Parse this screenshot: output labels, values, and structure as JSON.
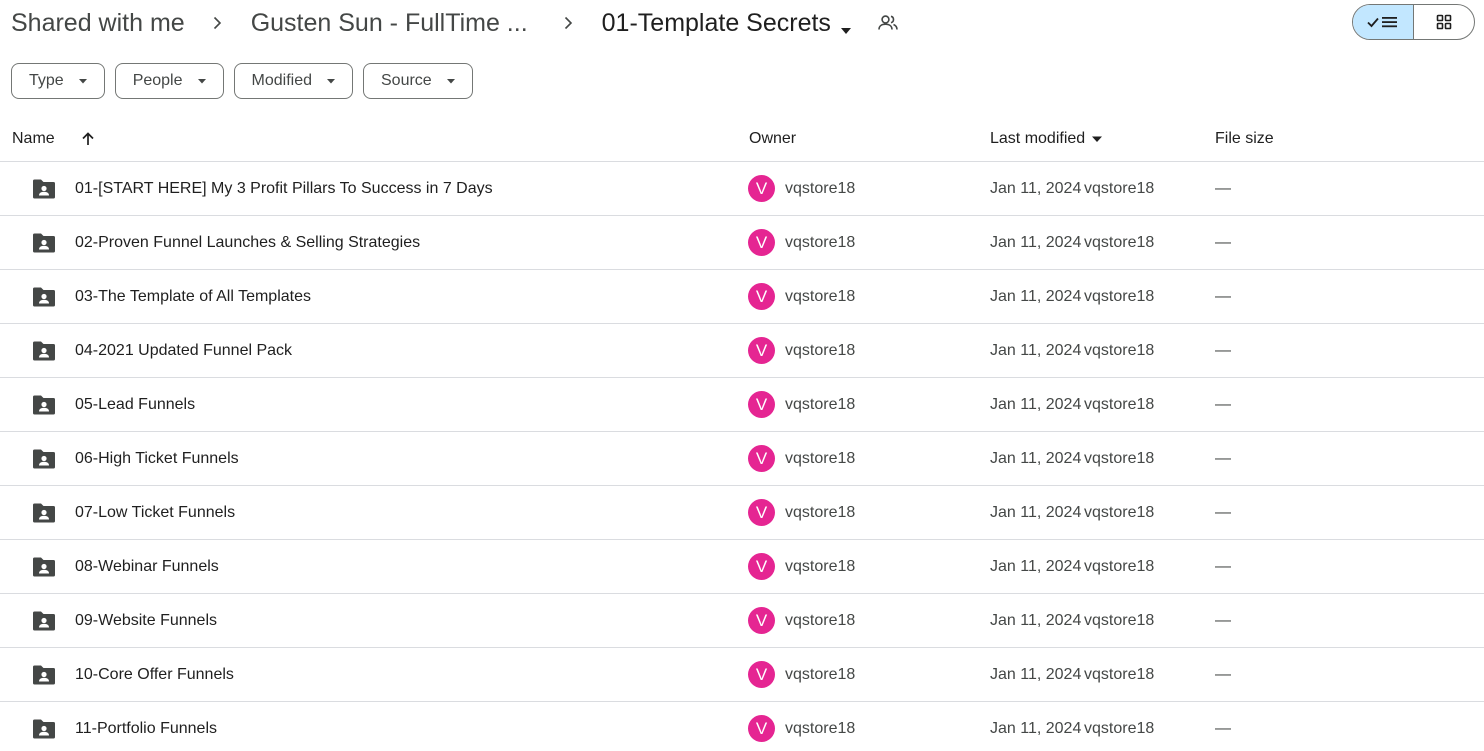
{
  "breadcrumb": {
    "items": [
      "Shared with me",
      "Gusten Sun - FullTime ..."
    ],
    "current": "01-Template Secrets"
  },
  "filters": [
    "Type",
    "People",
    "Modified",
    "Source"
  ],
  "columns": {
    "name": "Name",
    "owner": "Owner",
    "last_modified": "Last modified",
    "file_size": "File size"
  },
  "rows": [
    {
      "name": "01-[START HERE] My 3 Profit Pillars To Success in 7 Days",
      "avatar": "V",
      "owner": "vqstore18",
      "date": "Jan 11, 2024",
      "modified_by": "vqstore18",
      "size": "—"
    },
    {
      "name": "02-Proven Funnel Launches & Selling Strategies",
      "avatar": "V",
      "owner": "vqstore18",
      "date": "Jan 11, 2024",
      "modified_by": "vqstore18",
      "size": "—"
    },
    {
      "name": "03-The Template of All Templates",
      "avatar": "V",
      "owner": "vqstore18",
      "date": "Jan 11, 2024",
      "modified_by": "vqstore18",
      "size": "—"
    },
    {
      "name": "04-2021 Updated Funnel Pack",
      "avatar": "V",
      "owner": "vqstore18",
      "date": "Jan 11, 2024",
      "modified_by": "vqstore18",
      "size": "—"
    },
    {
      "name": "05-Lead Funnels",
      "avatar": "V",
      "owner": "vqstore18",
      "date": "Jan 11, 2024",
      "modified_by": "vqstore18",
      "size": "—"
    },
    {
      "name": "06-High Ticket Funnels",
      "avatar": "V",
      "owner": "vqstore18",
      "date": "Jan 11, 2024",
      "modified_by": "vqstore18",
      "size": "—"
    },
    {
      "name": "07-Low Ticket Funnels",
      "avatar": "V",
      "owner": "vqstore18",
      "date": "Jan 11, 2024",
      "modified_by": "vqstore18",
      "size": "—"
    },
    {
      "name": "08-Webinar Funnels",
      "avatar": "V",
      "owner": "vqstore18",
      "date": "Jan 11, 2024",
      "modified_by": "vqstore18",
      "size": "—"
    },
    {
      "name": "09-Website Funnels",
      "avatar": "V",
      "owner": "vqstore18",
      "date": "Jan 11, 2024",
      "modified_by": "vqstore18",
      "size": "—"
    },
    {
      "name": "10-Core Offer Funnels",
      "avatar": "V",
      "owner": "vqstore18",
      "date": "Jan 11, 2024",
      "modified_by": "vqstore18",
      "size": "—"
    },
    {
      "name": "11-Portfolio Funnels",
      "avatar": "V",
      "owner": "vqstore18",
      "date": "Jan 11, 2024",
      "modified_by": "vqstore18",
      "size": "—"
    }
  ],
  "colors": {
    "avatar_bg": "#e52592",
    "view_active_bg": "#c2e7ff",
    "divider": "#dadce0"
  },
  "icons": {
    "row": "shared-folder-icon",
    "sort": "arrow-up-icon",
    "view_list": "list-view-icon",
    "view_grid": "grid-view-icon"
  }
}
